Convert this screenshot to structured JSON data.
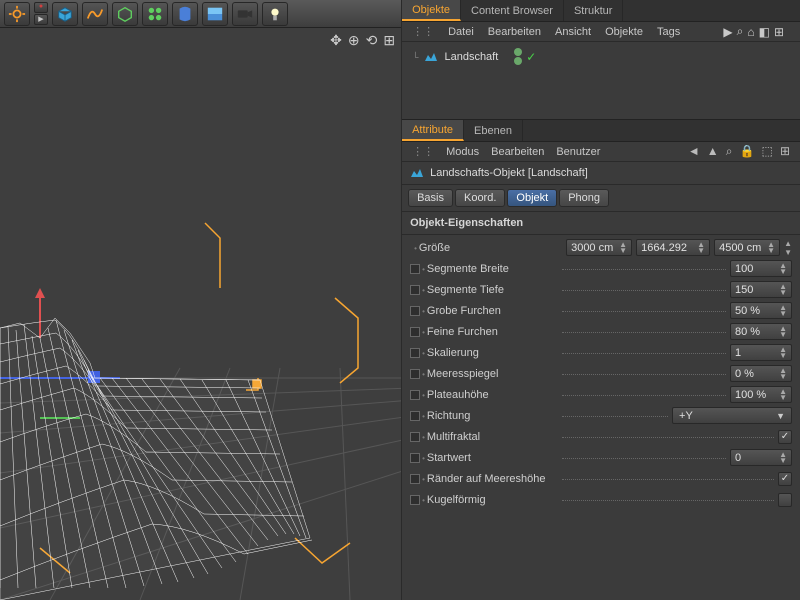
{
  "toolbar_icons": [
    "gear-icon",
    "cube-icon",
    "snake-icon",
    "cube-wire-icon",
    "molecule-icon",
    "shape-icon",
    "floor-icon",
    "camera-icon",
    "light-icon"
  ],
  "viewport_icons": [
    "axes-icon",
    "fit-icon",
    "grid-icon",
    "maximize-icon"
  ],
  "objects_panel": {
    "tabs": [
      "Objekte",
      "Content Browser",
      "Struktur"
    ],
    "menu": [
      "Datei",
      "Bearbeiten",
      "Ansicht",
      "Objekte",
      "Tags"
    ],
    "menu_icons": [
      "▶",
      "⌕",
      "⌂",
      "◧",
      "⊞"
    ],
    "tree_item": {
      "label": "Landschaft"
    }
  },
  "attributes_panel": {
    "tabs": [
      "Attribute",
      "Ebenen"
    ],
    "menu": [
      "Modus",
      "Bearbeiten",
      "Benutzer"
    ],
    "menu_icons": [
      "◄",
      "▲",
      "⌕",
      "🔒",
      "⬚",
      "⊞"
    ],
    "object_title": "Landschafts-Objekt [Landschaft]",
    "pill_tabs": [
      "Basis",
      "Koord.",
      "Objekt",
      "Phong"
    ],
    "section": "Objekt-Eigenschaften",
    "props": [
      {
        "k": "size",
        "label": "Größe",
        "type": "size",
        "v": [
          "3000 cm",
          "1664.292",
          "4500 cm"
        ]
      },
      {
        "k": "segw",
        "label": "Segmente Breite",
        "type": "num",
        "v": "100"
      },
      {
        "k": "segd",
        "label": "Segmente Tiefe",
        "type": "num",
        "v": "150"
      },
      {
        "k": "coarse",
        "label": "Grobe Furchen",
        "type": "num",
        "v": "50 %"
      },
      {
        "k": "fine",
        "label": "Feine Furchen",
        "type": "num",
        "v": "80 %"
      },
      {
        "k": "scale",
        "label": "Skalierung",
        "type": "num",
        "v": "1"
      },
      {
        "k": "sea",
        "label": "Meeresspiegel",
        "type": "num",
        "v": "0 %"
      },
      {
        "k": "plateau",
        "label": "Plateauhöhe",
        "type": "num",
        "v": "100 %"
      },
      {
        "k": "dir",
        "label": "Richtung",
        "type": "drop",
        "v": "+Y"
      },
      {
        "k": "multi",
        "label": "Multifraktal",
        "type": "check",
        "v": true
      },
      {
        "k": "seed",
        "label": "Startwert",
        "type": "num",
        "v": "0"
      },
      {
        "k": "border",
        "label": "Ränder auf Meereshöhe",
        "type": "check",
        "v": true
      },
      {
        "k": "sphere",
        "label": "Kugelförmig",
        "type": "check",
        "v": false
      }
    ]
  }
}
